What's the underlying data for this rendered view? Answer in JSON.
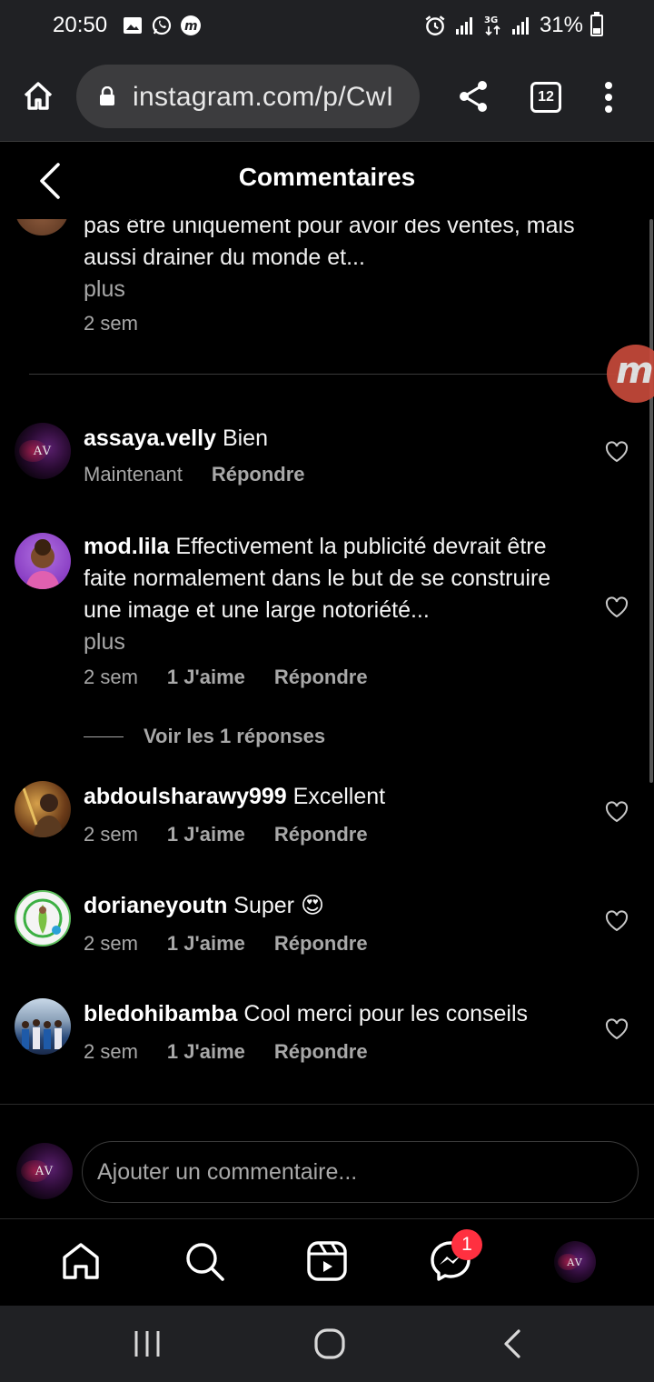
{
  "status_bar": {
    "time": "20:50",
    "battery": "31%",
    "network": "3G",
    "battery_level": 0.31
  },
  "browser": {
    "url": "instagram.com/p/CwI",
    "tab_count": "12"
  },
  "header": {
    "title": "Commentaires"
  },
  "truncated_comment": {
    "text": "pas être uniquement pour avoir des ventes, mais aussi drainer du monde et...",
    "more": "plus",
    "time": "2 sem"
  },
  "comments": [
    {
      "username": "assaya.velly",
      "text": "Bien",
      "time": "Maintenant",
      "likes": "",
      "reply": "Répondre"
    },
    {
      "username": "mod.lila",
      "text": "Effectivement la publicité devrait être faite normalement dans le but de se construire une image et une large notoriété...",
      "more": "plus",
      "time": "2 sem",
      "likes": "1 J'aime",
      "reply": "Répondre",
      "view_replies": "Voir les 1 réponses"
    },
    {
      "username": "abdoulsharawy999",
      "text": "Excellent",
      "time": "2 sem",
      "likes": "1 J'aime",
      "reply": "Répondre"
    },
    {
      "username": "dorianeyoutn",
      "text": "Super 😍",
      "time": "2 sem",
      "likes": "1 J'aime",
      "reply": "Répondre"
    },
    {
      "username": "bledohibamba",
      "text": "Cool merci pour les conseils",
      "time": "2 sem",
      "likes": "1 J'aime",
      "reply": "Répondre"
    }
  ],
  "composer": {
    "placeholder": "Ajouter un commentaire...",
    "avatar_text": "AV"
  },
  "bottom_nav": {
    "messages_badge": "1"
  },
  "floating_badge": "m",
  "colors": {
    "background": "#000000",
    "chrome": "#202124",
    "secondary_text": "#a8a8a8",
    "badge_red": "#ff3040"
  }
}
